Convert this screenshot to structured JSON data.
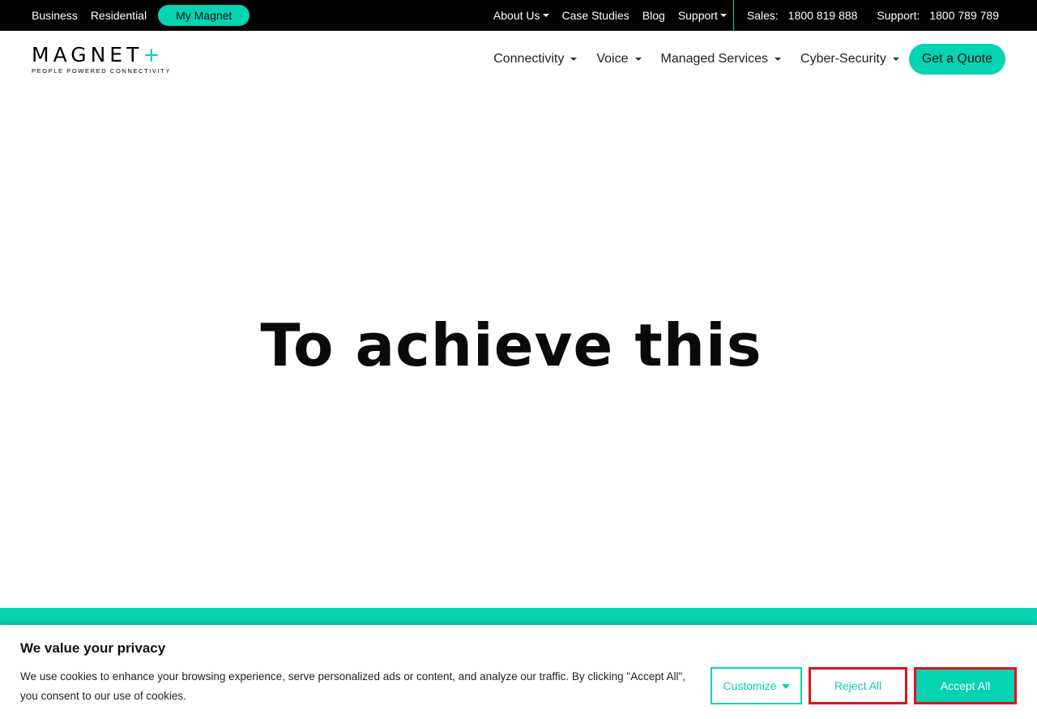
{
  "topbar": {
    "left_links": [
      "Business",
      "Residential"
    ],
    "my_magnet": "My Magnet",
    "menu": {
      "about": "About Us",
      "case_studies": "Case Studies",
      "blog": "Blog",
      "support": "Support"
    },
    "sales_label": "Sales:",
    "sales_number": "1800 819 888",
    "support_label": "Support:",
    "support_number": "1800 789 789"
  },
  "logo": {
    "word": "MAGNET",
    "plus": "+",
    "tagline": "PEOPLE POWERED CONNECTIVITY"
  },
  "nav": {
    "items": [
      "Connectivity",
      "Voice",
      "Managed Services",
      "Cyber-Security"
    ],
    "cta": "Get a Quote"
  },
  "hero": {
    "text": "To achieve this"
  },
  "cookie": {
    "title": "We value your privacy",
    "body": "We use cookies to enhance your browsing experience, serve personalized ads or content, and analyze our traffic. By clicking \"Accept All\", you consent to our use of cookies.",
    "customize": "Customize",
    "reject": "Reject All",
    "accept": "Accept All"
  },
  "colors": {
    "accent": "#06d3b1",
    "highlight_border": "#e0131b"
  }
}
